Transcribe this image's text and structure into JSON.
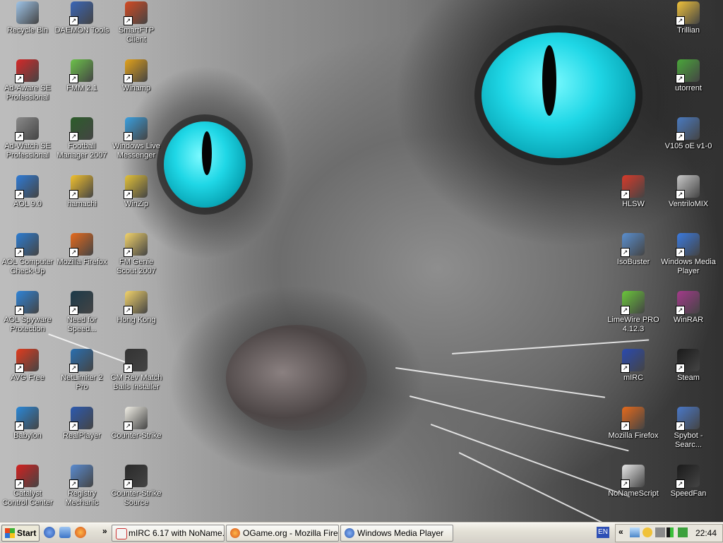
{
  "desktop": {
    "icons": [
      {
        "label": "Recycle Bin",
        "icon": "recycle-bin-icon",
        "color": "#9ec4e8"
      },
      {
        "label": "DAEMON Tools",
        "icon": "daemon-tools-icon",
        "color": "#3a66b8"
      },
      {
        "label": "SmartFTP Client",
        "icon": "smartftp-icon",
        "color": "#d44a22"
      },
      {
        "label": "Ad-Aware SE Professional",
        "icon": "ad-aware-icon",
        "color": "#d62828"
      },
      {
        "label": "FMM 2.1",
        "icon": "fmm-icon",
        "color": "#6cc24a"
      },
      {
        "label": "Winamp",
        "icon": "winamp-icon",
        "color": "#e3a21a"
      },
      {
        "label": "Ad-Watch SE Professional",
        "icon": "ad-watch-icon",
        "color": "#8a8a8a"
      },
      {
        "label": "Football Manager 2007",
        "icon": "football-manager-icon",
        "color": "#2c5d2a"
      },
      {
        "label": "Windows Live Messenger",
        "icon": "messenger-icon",
        "color": "#3aa0e0"
      },
      {
        "label": "AOL 9.0",
        "icon": "aol-icon",
        "color": "#2f7bd6"
      },
      {
        "label": "hamachi",
        "icon": "hamachi-icon",
        "color": "#f2c12e"
      },
      {
        "label": "WinZip",
        "icon": "winzip-icon",
        "color": "#e3c238"
      },
      {
        "label": "AOL Computer Check-Up",
        "icon": "aol-checkup-icon",
        "color": "#2c7cd1"
      },
      {
        "label": "Mozilla Firefox",
        "icon": "firefox-icon",
        "color": "#e66a1c"
      },
      {
        "label": "FM Genie Scout 2007",
        "icon": "folder-icon",
        "color": "#f2d36b"
      },
      {
        "label": "AOL Spyware Protection",
        "icon": "aol-spyware-icon",
        "color": "#2f84d8"
      },
      {
        "label": "Need for Speed...",
        "icon": "nfs-icon",
        "color": "#1c3a4a"
      },
      {
        "label": "Hong Kong",
        "icon": "folder-icon",
        "color": "#f2d36b"
      },
      {
        "label": "AVG Free",
        "icon": "avg-icon",
        "color": "#e23b1d"
      },
      {
        "label": "NetLimiter 2 Pro",
        "icon": "netlimiter-icon",
        "color": "#2a6fb0"
      },
      {
        "label": "CM Rev Match Balls Installer",
        "icon": "installer-icon",
        "color": "#333333"
      },
      {
        "label": "Babylon",
        "icon": "babylon-icon",
        "color": "#2a88d8"
      },
      {
        "label": "RealPlayer",
        "icon": "realplayer-icon",
        "color": "#2c5ab0"
      },
      {
        "label": "Counter-Strike",
        "icon": "counter-strike-icon",
        "color": "#f1efe6"
      },
      {
        "label": "Catalyst Control Center",
        "icon": "ati-icon",
        "color": "#d3201f"
      },
      {
        "label": "Registry Mechanic",
        "icon": "registry-mechanic-icon",
        "color": "#5a8bd0"
      },
      {
        "label": "Counter-Strike Source",
        "icon": "cs-source-icon",
        "color": "#2a2a2a"
      }
    ],
    "right_icons": [
      {
        "label": "Trillian",
        "icon": "trillian-icon",
        "color": "#f0c23a"
      },
      {
        "label": "utorrent",
        "icon": "utorrent-icon",
        "color": "#4aa63a"
      },
      {
        "label": "V105 oE v1-0",
        "icon": "v105-icon",
        "color": "#4a7ac0"
      },
      {
        "label": "HLSW",
        "icon": "hlsw-icon",
        "color": "#d83a2a"
      },
      {
        "label": "VentriloMIX",
        "icon": "ventrilo-icon",
        "color": "#c8c8c8"
      },
      {
        "label": "IsoBuster",
        "icon": "isobuster-icon",
        "color": "#5a8fd0"
      },
      {
        "label": "Windows Media Player",
        "icon": "media-player-icon",
        "color": "#3a7ae0"
      },
      {
        "label": "LimeWire PRO 4.12.3",
        "icon": "limewire-icon",
        "color": "#6ac63a"
      },
      {
        "label": "WinRAR",
        "icon": "winrar-icon",
        "color": "#a33a8a"
      },
      {
        "label": "mIRC",
        "icon": "mirc-icon",
        "color": "#2a4ab0"
      },
      {
        "label": "Steam",
        "icon": "steam-icon",
        "color": "#1a1a1a"
      },
      {
        "label": "Mozilla Firefox",
        "icon": "firefox-icon",
        "color": "#e66a1c"
      },
      {
        "label": "Spybot - Searc...",
        "icon": "spybot-icon",
        "color": "#4a78c8"
      },
      {
        "label": "NoNameScript",
        "icon": "nonamescript-icon",
        "color": "#e8e8e8"
      },
      {
        "label": "SpeedFan",
        "icon": "speedfan-icon",
        "color": "#1a1a1a"
      }
    ]
  },
  "taskbar": {
    "start_label": "Start",
    "tasks": [
      {
        "label": "mIRC 6.17 with NoName...",
        "icon": "nonamescript-icon"
      },
      {
        "label": "OGame.org - Mozilla Fire...",
        "icon": "firefox-icon"
      },
      {
        "label": "Windows Media Player",
        "icon": "media-player-icon"
      }
    ],
    "language": "EN",
    "clock": "22:44",
    "chevron": "»",
    "tray_chevron": "«"
  },
  "colors": {
    "eye": "#1fd7e6",
    "taskbar": "#d4d0c8"
  }
}
